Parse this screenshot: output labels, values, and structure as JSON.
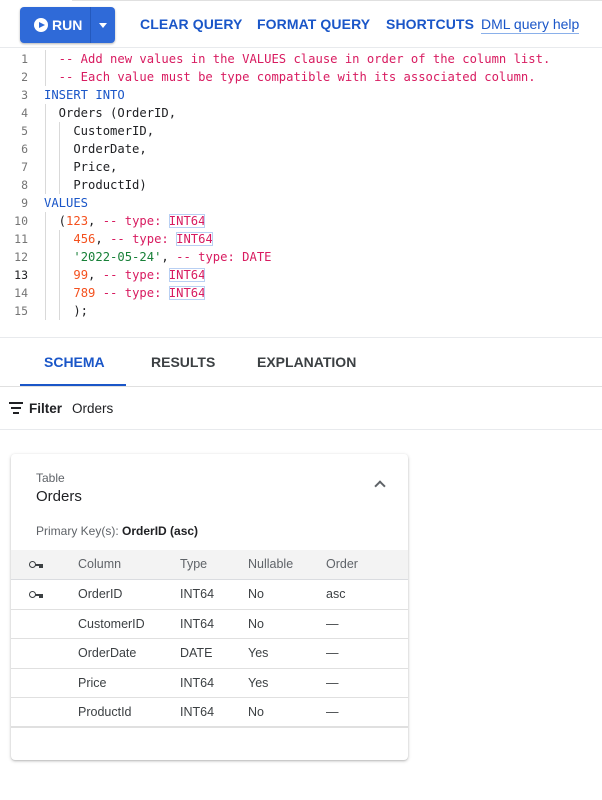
{
  "toolbar": {
    "run_label": "RUN",
    "run_icon": "play-circle-icon",
    "run_dropdown_icon": "caret-down-icon",
    "clear_query": "CLEAR QUERY",
    "format_query": "FORMAT QUERY",
    "shortcuts": "SHORTCUTS",
    "help_link": "DML query help"
  },
  "editor": {
    "active_line": 13,
    "lines": [
      {
        "n": "1",
        "tokens": [
          {
            "t": "comment",
            "v": "  -- Add new values in the VALUES clause in order of the column list."
          }
        ]
      },
      {
        "n": "2",
        "tokens": [
          {
            "t": "comment",
            "v": "  -- Each value must be type compatible with its associated column."
          }
        ]
      },
      {
        "n": "3",
        "tokens": [
          {
            "t": "kw",
            "v": "INSERT INTO"
          }
        ]
      },
      {
        "n": "4",
        "tokens": [
          {
            "t": "plain",
            "v": "  Orders (OrderID,"
          }
        ]
      },
      {
        "n": "5",
        "tokens": [
          {
            "t": "plain",
            "v": "    CustomerID,"
          }
        ]
      },
      {
        "n": "6",
        "tokens": [
          {
            "t": "plain",
            "v": "    OrderDate,"
          }
        ]
      },
      {
        "n": "7",
        "tokens": [
          {
            "t": "plain",
            "v": "    Price,"
          }
        ]
      },
      {
        "n": "8",
        "tokens": [
          {
            "t": "plain",
            "v": "    ProductId)"
          }
        ]
      },
      {
        "n": "9",
        "tokens": [
          {
            "t": "kw",
            "v": "VALUES"
          }
        ]
      },
      {
        "n": "10",
        "tokens": [
          {
            "t": "plain",
            "v": "  ("
          },
          {
            "t": "num",
            "v": "123"
          },
          {
            "t": "plain",
            "v": ", "
          },
          {
            "t": "comment",
            "v": "-- type: "
          },
          {
            "t": "type",
            "v": "INT64"
          }
        ]
      },
      {
        "n": "11",
        "tokens": [
          {
            "t": "plain",
            "v": "    "
          },
          {
            "t": "num",
            "v": "456"
          },
          {
            "t": "plain",
            "v": ", "
          },
          {
            "t": "comment",
            "v": "-- type: "
          },
          {
            "t": "type",
            "v": "INT64"
          }
        ]
      },
      {
        "n": "12",
        "tokens": [
          {
            "t": "plain",
            "v": "    "
          },
          {
            "t": "str",
            "v": "'2022-05-24'"
          },
          {
            "t": "plain",
            "v": ", "
          },
          {
            "t": "comment",
            "v": "-- type: DATE"
          }
        ]
      },
      {
        "n": "13",
        "tokens": [
          {
            "t": "plain",
            "v": "    "
          },
          {
            "t": "num",
            "v": "99"
          },
          {
            "t": "plain",
            "v": ", "
          },
          {
            "t": "comment",
            "v": "-- type: "
          },
          {
            "t": "type",
            "v": "INT64"
          }
        ]
      },
      {
        "n": "14",
        "tokens": [
          {
            "t": "plain",
            "v": "    "
          },
          {
            "t": "num",
            "v": "789"
          },
          {
            "t": "plain",
            "v": " "
          },
          {
            "t": "comment",
            "v": "-- type: "
          },
          {
            "t": "type",
            "v": "INT64"
          }
        ]
      },
      {
        "n": "15",
        "tokens": [
          {
            "t": "plain",
            "v": "    );"
          }
        ]
      }
    ]
  },
  "tabs": [
    {
      "label": "SCHEMA",
      "active": true
    },
    {
      "label": "RESULTS",
      "active": false
    },
    {
      "label": "EXPLANATION",
      "active": false
    }
  ],
  "filter": {
    "icon": "filter-list-icon",
    "label": "Filter",
    "value": "Orders"
  },
  "schema_card": {
    "kind": "Table",
    "name": "Orders",
    "collapse_icon": "chevron-up-icon",
    "primary_key_label": "Primary Key(s):",
    "primary_key_value": "OrderID (asc)",
    "columns_header": {
      "key": "key-icon",
      "column": "Column",
      "type": "Type",
      "nullable": "Nullable",
      "order": "Order"
    },
    "rows": [
      {
        "is_key": true,
        "column": "OrderID",
        "type": "INT64",
        "nullable": "No",
        "order": "asc"
      },
      {
        "is_key": false,
        "column": "CustomerID",
        "type": "INT64",
        "nullable": "No",
        "order": "—"
      },
      {
        "is_key": false,
        "column": "OrderDate",
        "type": "DATE",
        "nullable": "Yes",
        "order": "—"
      },
      {
        "is_key": false,
        "column": "Price",
        "type": "INT64",
        "nullable": "Yes",
        "order": "—"
      },
      {
        "is_key": false,
        "column": "ProductId",
        "type": "INT64",
        "nullable": "No",
        "order": "—"
      }
    ]
  },
  "colors": {
    "accent": "#1a56c8",
    "run_button": "#2f6ad8",
    "comment": "#d81b60",
    "number": "#f4511e",
    "string": "#188038"
  }
}
